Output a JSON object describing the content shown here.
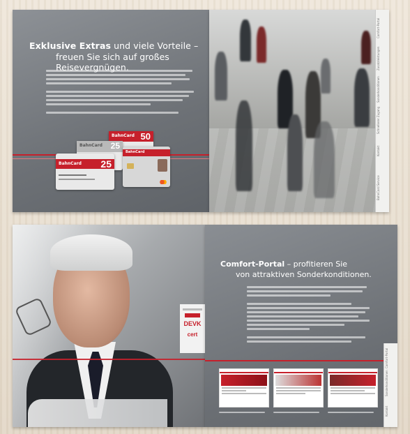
{
  "top_spread": {
    "left_page": {
      "title_bold": "Exklusive Extras",
      "title_rest": " und viele Vorteile –",
      "title_line2": "freuen Sie sich auf großes Reisevergnügen.",
      "cards": [
        {
          "label": "BahnCard",
          "number": "50"
        },
        {
          "label": "BahnCard",
          "number": "25"
        },
        {
          "label": "BahnCard",
          "number": "25"
        },
        {
          "label": "BahnCard",
          "number": ""
        }
      ]
    },
    "right_page": {
      "tabs": [
        "Comfort-Portal",
        "Zusatzleistungen",
        "Sonderkonditionen",
        "Schnellerer Zugang",
        "Kontakt",
        "BahnCard Service"
      ]
    }
  },
  "bottom_spread": {
    "left_page": {
      "sponsors": [
        "DEVK",
        "cert"
      ]
    },
    "right_page": {
      "title_bold": "Comfort-Portal",
      "title_rest": " – profitieren Sie",
      "title_line2": "von attraktiven Sonderkonditionen.",
      "tabs": [
        "Comfort-Portal",
        "Sonderkonditionen",
        "Kontakt"
      ]
    }
  },
  "colors": {
    "db_red": "#c6202b",
    "page_grey": "#6d7176",
    "background": "#e8e0d4"
  }
}
